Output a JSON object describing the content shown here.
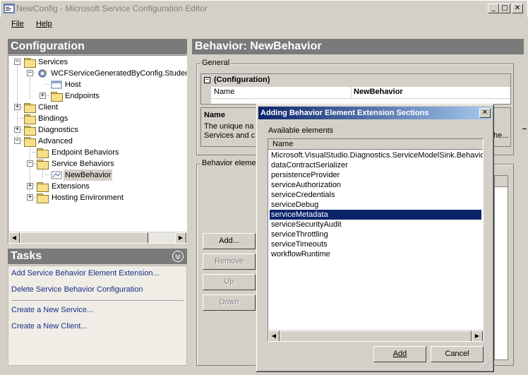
{
  "window": {
    "title": "NewConfig - Microsoft Service Configuration Editor",
    "min": "_",
    "max": "□",
    "close": "✕"
  },
  "menu": [
    {
      "label": "File"
    },
    {
      "label": "Help"
    }
  ],
  "configuration": {
    "header": "Configuration",
    "tree": [
      {
        "label": "Services",
        "level": 0,
        "expander": "−"
      },
      {
        "label": "WCFServiceGeneratedByConfig.Student",
        "level": 1,
        "expander": "−"
      },
      {
        "label": "Host",
        "level": 2,
        "expander": ""
      },
      {
        "label": "Endpoints",
        "level": 2,
        "expander": "+"
      },
      {
        "label": "Client",
        "level": 0,
        "expander": "+"
      },
      {
        "label": "Bindings",
        "level": 0,
        "expander": ""
      },
      {
        "label": "Diagnostics",
        "level": 0,
        "expander": "+"
      },
      {
        "label": "Advanced",
        "level": 0,
        "expander": "−"
      },
      {
        "label": "Endpoint Behaviors",
        "level": 1,
        "expander": ""
      },
      {
        "label": "Service Behaviors",
        "level": 1,
        "expander": "−"
      },
      {
        "label": "NewBehavior",
        "level": 2,
        "expander": ""
      },
      {
        "label": "Extensions",
        "level": 1,
        "expander": "+"
      },
      {
        "label": "Hosting Environment",
        "level": 1,
        "expander": "+"
      }
    ]
  },
  "tasks": {
    "header": "Tasks",
    "links": [
      "Add Service Behavior Element Extension...",
      "Delete Service Behavior Configuration",
      "Create a New Service...",
      "Create a New Client..."
    ]
  },
  "behavior": {
    "header": "Behavior: NewBehavior",
    "general_title": "General",
    "config_section": "(Configuration)",
    "prop_name_label": "Name",
    "prop_name_value": "NewBehavior",
    "desc_title": "Name",
    "desc_line1": "The unique na",
    "desc_line2": "Services and c",
    "desc_trail": "he...",
    "elements_title": "Behavior eleme",
    "buttons": {
      "add": "Add...",
      "remove": "Remove",
      "up": "Up",
      "down": "Down"
    }
  },
  "dialog": {
    "title": "Adding Behavior Element Extension Sections",
    "available_label": "Available elements",
    "column_header": "Name",
    "items": [
      "Microsoft.VisualStudio.Diagnostics.ServiceModelSink.Behavior",
      "dataContractSerializer",
      "persistenceProvider",
      "serviceAuthorization",
      "serviceCredentials",
      "serviceDebug",
      "serviceMetadata",
      "serviceSecurityAudit",
      "serviceThrottling",
      "serviceTimeouts",
      "workflowRuntime"
    ],
    "selected_item": "serviceMetadata",
    "add_button": "Add",
    "cancel_button": "Cancel"
  },
  "colors": {
    "selection": "#0a246a",
    "task_link": "#1a2f8a",
    "section_header": "#7a7a7a"
  }
}
